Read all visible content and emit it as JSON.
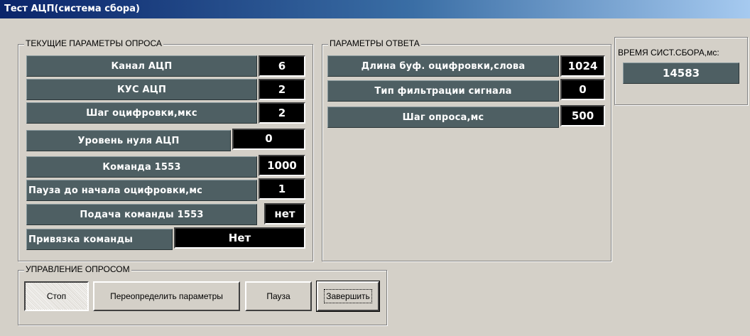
{
  "window": {
    "title": "Тест АЦП(система сбора)"
  },
  "current_params": {
    "legend": "ТЕКУЩИЕ ПАРАМЕТРЫ ОПРОСА",
    "rows": [
      {
        "label": "Канал АЦП",
        "value": "6"
      },
      {
        "label": "КУС АЦП",
        "value": "2"
      },
      {
        "label": "Шаг оцифровки,мкс",
        "value": "2"
      },
      {
        "label": "Уровень нуля АЦП",
        "value": "0"
      },
      {
        "label": "Команда 1553",
        "value": "1000"
      },
      {
        "label": "Пауза до начала оцифровки,мс",
        "value": "1"
      },
      {
        "label": "Подача команды 1553",
        "value": "нет"
      },
      {
        "label": "Привязка команды",
        "value": "Нет"
      }
    ]
  },
  "response_params": {
    "legend": "ПАРАМЕТРЫ ОТВЕТА",
    "rows": [
      {
        "label": "Длина буф. оцифровки,слова",
        "value": "1024"
      },
      {
        "label": "Тип фильтрации сигнала",
        "value": "0"
      },
      {
        "label": "Шаг опроса,мс",
        "value": "500"
      }
    ]
  },
  "system_time": {
    "label": "ВРЕМЯ СИСТ.СБОРА,мс:",
    "value": "14583"
  },
  "control": {
    "legend": "УПРАВЛЕНИЕ ОПРОСОМ",
    "stop_label": "Стоп",
    "redefine_label": "Переопределить параметры",
    "pause_label": "Пауза",
    "finish_label": "Завершить"
  },
  "colors": {
    "title_start": "#0a246a",
    "title_end": "#a6caf0",
    "label_bg": "#4e5f63",
    "value_bg": "#000000",
    "window_bg": "#d4d0c8"
  }
}
